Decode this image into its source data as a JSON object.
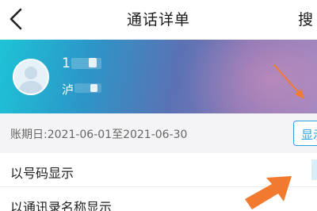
{
  "header": {
    "title": "通话详单",
    "search_label": "搜"
  },
  "profile": {
    "phone_visible": "1",
    "sub_visible": "泸"
  },
  "billing": {
    "period_label": "账期日:2021-06-01至2021-06-30",
    "display_button_label": "显示"
  },
  "menu": {
    "items": [
      {
        "label": "以号码显示"
      },
      {
        "label": "以通讯录名称显示"
      }
    ]
  },
  "colors": {
    "accent": "#2aa3dc",
    "arrow": "#f27a2e",
    "banner_start": "#1ec3d6",
    "banner_end": "#9d86c0"
  }
}
